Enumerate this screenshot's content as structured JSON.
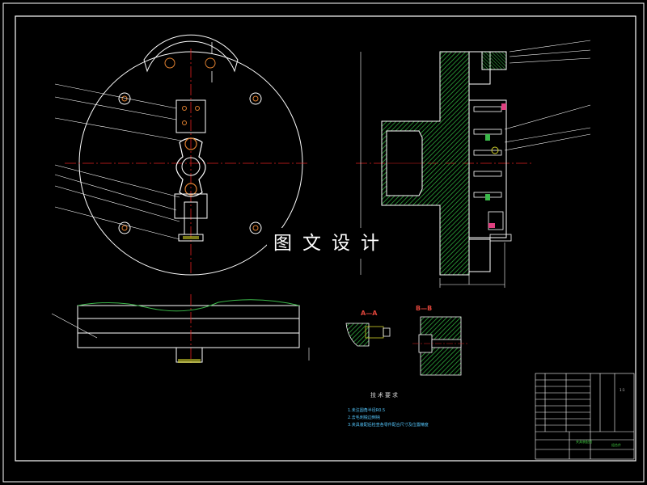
{
  "watermark": "图文设计",
  "section_labels": {
    "a": "A—A",
    "b": "B—B"
  },
  "technical_requirements": {
    "title": "技术要求",
    "items": [
      "1.未注圆角半径R0.5",
      "2.去毛刺锐边倒钝",
      "3.夹具装配后检查各零件配合尺寸及位置精度"
    ]
  },
  "title_block": {
    "drawing_title": "夹具装配图",
    "material": "组合件",
    "scale": "1:1"
  },
  "colors": {
    "background": "#000000",
    "outline": "#ffffff",
    "center_line": "#e02020",
    "leader": "#ffffff",
    "hatch": "#3bb84a",
    "dimension": "#ffffff",
    "hidden": "#cfcf2a"
  }
}
